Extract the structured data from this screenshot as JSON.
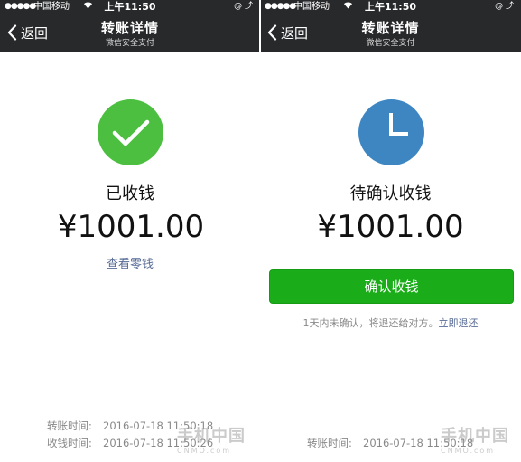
{
  "status_bar": {
    "signal": "●●●●●",
    "carrier": "中国移动",
    "time": "上午11:50",
    "right_icons": "@ ⤴"
  },
  "nav": {
    "back_label": "返回",
    "title": "转账详情",
    "subtitle": "微信安全支付"
  },
  "left_screen": {
    "status_icon": "checkmark-icon",
    "status_text": "已收钱",
    "amount": "¥1001.00",
    "link": "查看零钱",
    "rows": [
      {
        "label": "转账时间:",
        "value": "2016-07-18 11:50:18"
      },
      {
        "label": "收钱时间:",
        "value": "2016-07-18 11:50:26"
      }
    ],
    "watermark": "手机中国",
    "watermark_sub": "CNMO.com"
  },
  "right_screen": {
    "status_icon": "clock-icon",
    "status_text": "待确认收钱",
    "amount": "¥1001.00",
    "button": "确认收钱",
    "note_text": "1天内未确认，将退还给对方。",
    "note_link": "立即退还",
    "rows": [
      {
        "label": "转账时间:",
        "value": "2016-07-18 11:50:18"
      }
    ],
    "watermark": "手机中国",
    "watermark_sub": "CNMO.com"
  },
  "colors": {
    "nav_background": "#28292b",
    "success_green": "#4cbf40",
    "pending_blue": "#3d86c2",
    "button_green": "#1aad19",
    "link_blue": "#576b95"
  }
}
